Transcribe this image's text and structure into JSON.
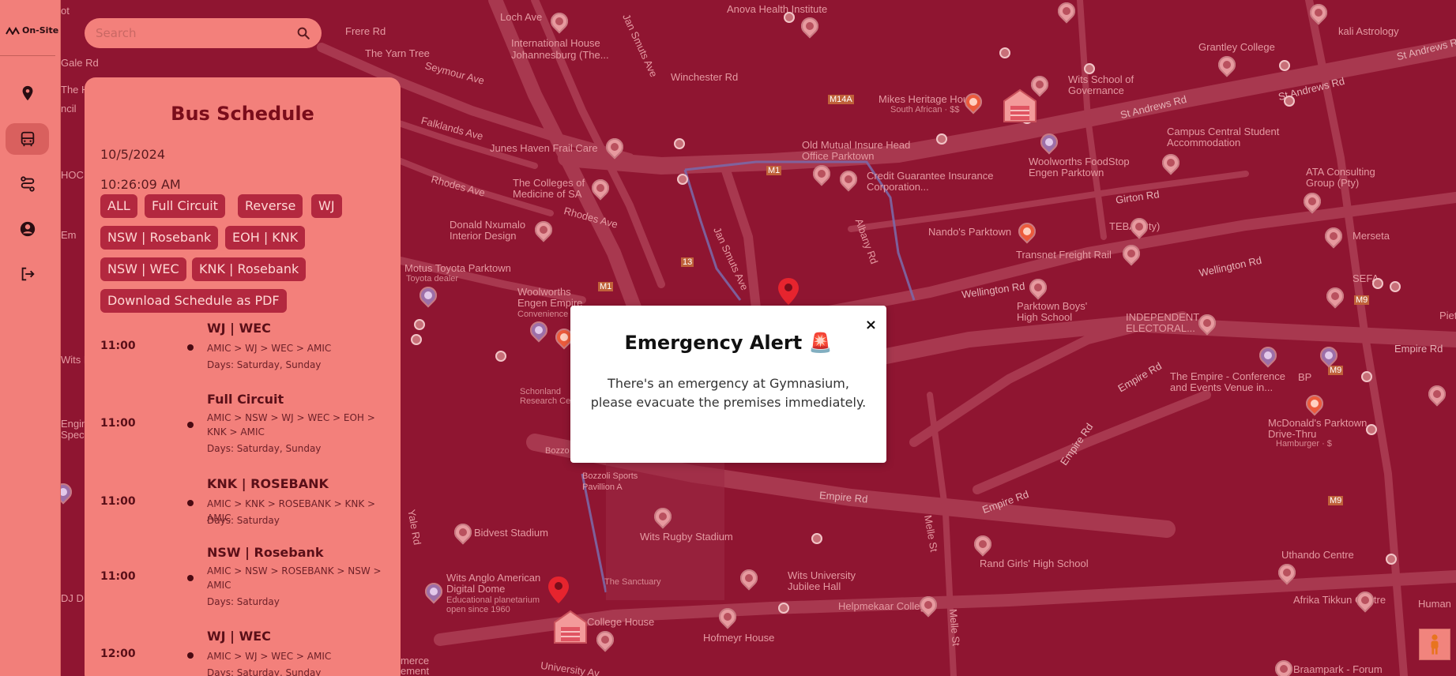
{
  "app": {
    "logo_text": "On-Site"
  },
  "sidebar": {
    "items": [
      {
        "name": "location",
        "icon": "map-pin-icon",
        "active": false
      },
      {
        "name": "bus",
        "icon": "bus-icon",
        "active": true
      },
      {
        "name": "routes",
        "icon": "route-icon",
        "active": false
      },
      {
        "name": "profile",
        "icon": "user-circle-icon",
        "active": false
      },
      {
        "name": "logout",
        "icon": "logout-icon",
        "active": false
      }
    ]
  },
  "search": {
    "placeholder": "Search",
    "value": ""
  },
  "schedule": {
    "title": "Bus Schedule",
    "date": "10/5/2024",
    "time": "10:26:09 AM",
    "filters": [
      "ALL",
      "Full Circuit",
      "Reverse",
      "WJ",
      "NSW | Rosebank",
      "EOH | KNK",
      "NSW | WEC",
      "KNK | Rosebank",
      "Download Schedule as PDF"
    ],
    "trips": [
      {
        "time": "11:00",
        "name": "WJ | WEC",
        "route": "AMIC > WJ > WEC > AMIC",
        "days": "Days: Saturday, Sunday"
      },
      {
        "time": "11:00",
        "name": "Full Circuit",
        "route": "AMIC > NSW > WJ > WEC > EOH > KNK > AMIC",
        "days": "Days: Saturday, Sunday"
      },
      {
        "time": "11:00",
        "name": "KNK | ROSEBANK",
        "route": "AMIC > KNK > ROSEBANK > KNK > AMIC",
        "days": "Days: Saturday"
      },
      {
        "time": "11:00",
        "name": "NSW | Rosebank",
        "route": "AMIC > NSW > ROSEBANK > NSW > AMIC",
        "days": "Days: Saturday"
      },
      {
        "time": "12:00",
        "name": "WJ | WEC",
        "route": "AMIC > WJ > WEC > AMIC",
        "days": "Days: Saturday, Sunday"
      }
    ]
  },
  "modal": {
    "title": "Emergency Alert 🚨",
    "body": "There's an emergency at Gymnasium, please evacuate the premises immediately.",
    "close_label": "×"
  },
  "map": {
    "labels": {
      "loch_ave": "Loch Ave",
      "anova": "Anova Health Institute",
      "kali": "kali Astrology",
      "frere": "Frere Rd",
      "yarn_tree": "The Yarn Tree",
      "intl_house": "International House Johannesburg (The...",
      "jan_smuts_top": "Jan Smuts Ave",
      "winchester": "Winchester Rd",
      "grantley": "Grantley College",
      "st_andrews_rd": "St Andrews Rd",
      "st_andrews_rd2": "St Andrews Rd",
      "st_andrews_r": "St Andrews R",
      "gale": "Gale Rd",
      "seymour": "Seymour Ave",
      "mikes": "Mikes Heritage House",
      "mikes_sub": "South African · $$",
      "wits_gov": "Wits School of Governance",
      "falklands": "Falklands Ave",
      "junes": "Junes Haven Frail Care",
      "old_mutual": "Old Mutual Insure Head Office Parktown",
      "campus_central": "Campus Central Student Accommodation",
      "credit_guarantee": "Credit Guarantee Insurance Corporation...",
      "woolworths_food": "Woolworths FoodStop Engen Parktown",
      "ata": "ATA Consulting Group (Pty)",
      "colleges": "The Colleges of Medicine of SA",
      "rhodes1": "Rhodes Ave",
      "rhodes2": "Rhodes Ave",
      "girton": "Girton Rd",
      "donald": "Donald Nxumalo Interior Design",
      "nandos": "Nando's Parktown",
      "teba": "TEBA (Pty)",
      "merseta": "Merseta",
      "transnet": "Transnet Freight Rail",
      "motus": "Motus Toyota Parktown",
      "motus_sub": "Toyota dealer",
      "woolworths_engen": "Woolworths Engen Empire",
      "woolworths_engen_sub": "Convenience",
      "jan_smuts_mid": "Jan Smuts Ave",
      "albany": "Albany Rd",
      "wellington1": "Wellington Rd",
      "wellington2": "Wellington Rd",
      "sefa": "SEFA",
      "parktown_boys": "Parktown Boys' High School",
      "iec": "INDEPENDENT ELECTORAL...",
      "empire_rd_r": "Empire Rd",
      "empire_rd_diag": "Empire Rd",
      "the_empire": "The Empire - Conference and Events Venue in...",
      "bp": "BP",
      "mcdonalds": "McDonald's Parktown Drive-Thru",
      "mcdonalds_sub": "Hamburger · $",
      "empire_rd_diag2": "Empire Rd",
      "empire_rd_mid": "Empire Rd",
      "empire_rd_low": "Empire Rd",
      "bozzoli": "Bozzoli Sports Pavillion A",
      "bozzo": "Bozzo",
      "wits_rugby": "Wits Rugby Stadium",
      "bidvest": "Bidvest Stadium",
      "yale": "Yale Rd",
      "melle1": "Melle St",
      "melle2": "Melle St",
      "rand_girls": "Rand Girls' High School",
      "uthando": "Uthando Centre",
      "anglo": "Wits Anglo American Digital Dome",
      "anglo_sub": "Educational planetarium open since 1960",
      "sanctuary": "The Sanctuary",
      "wits_jubilee": "Wits University Jubilee Hall",
      "helpmekaar": "Helpmekaar College",
      "afrika": "Afrika Tikkun Centre",
      "human": "Human",
      "college_house": "College House",
      "hofmeyr": "Hofmeyr House",
      "braampark": "Braampark - Forum",
      "university": "University Av",
      "schonland": "Schonland Research Cen",
      "pietet": "Piete",
      "ot": "ot",
      "the_h": "The H",
      "hoc": "HOC",
      "ncil": "ncil",
      "ngin": "Engin Spec",
      "wits_dev": "Wits Dev",
      "jdj": "DJ D",
      "merce": "merce ement",
      "em": "Em",
      "m1a": "M1",
      "m1b": "M1",
      "m9a": "M9",
      "m9b": "M9",
      "m9c": "M9",
      "m14a": "M14A",
      "m13": "13"
    }
  },
  "colors": {
    "map_bg": "#8f1531",
    "panel": "#f3807b",
    "chip": "#b3283f",
    "accent": "#7a0d1b"
  }
}
